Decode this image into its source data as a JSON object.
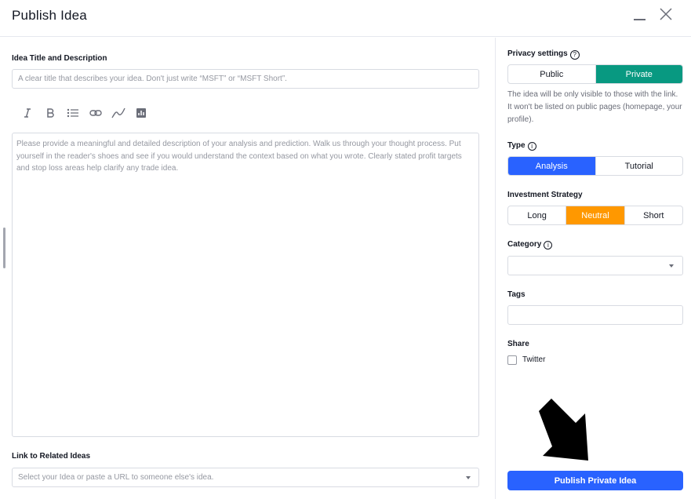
{
  "header": {
    "title": "Publish Idea"
  },
  "left": {
    "title_label": "Idea Title and Description",
    "title_placeholder": "A clear title that describes your idea. Don't just write “MSFT” or “MSFT Short”.",
    "toolbar_icons": [
      "italic-icon",
      "bold-icon",
      "list-icon",
      "link-icon",
      "drawing-icon",
      "chart-icon"
    ],
    "description_placeholder": "Please provide a meaningful and detailed description of your analysis and prediction. Walk us through your thought process. Put yourself in the reader's shoes and see if you would understand the context based on what you wrote. Clearly stated profit targets and stop loss areas help clarify any trade idea.",
    "related_label": "Link to Related Ideas",
    "related_placeholder": "Select your Idea or paste a URL to someone else's idea."
  },
  "right": {
    "privacy": {
      "label": "Privacy settings",
      "options": [
        "Public",
        "Private"
      ],
      "selected": "Private",
      "selected_color": "#089981",
      "description": "The idea will be only visible to those with the link. It won't be listed on public pages (homepage, your profile)."
    },
    "type": {
      "label": "Type",
      "options": [
        "Analysis",
        "Tutorial"
      ],
      "selected": "Analysis",
      "selected_color": "#2962ff"
    },
    "strategy": {
      "label": "Investment Strategy",
      "options": [
        "Long",
        "Neutral",
        "Short"
      ],
      "selected": "Neutral",
      "selected_color": "#ff9800"
    },
    "category": {
      "label": "Category",
      "value": ""
    },
    "tags": {
      "label": "Tags",
      "value": ""
    },
    "share": {
      "label": "Share",
      "twitter_label": "Twitter",
      "twitter_checked": false
    },
    "publish_button": "Publish Private Idea",
    "publish_color": "#2962ff"
  }
}
